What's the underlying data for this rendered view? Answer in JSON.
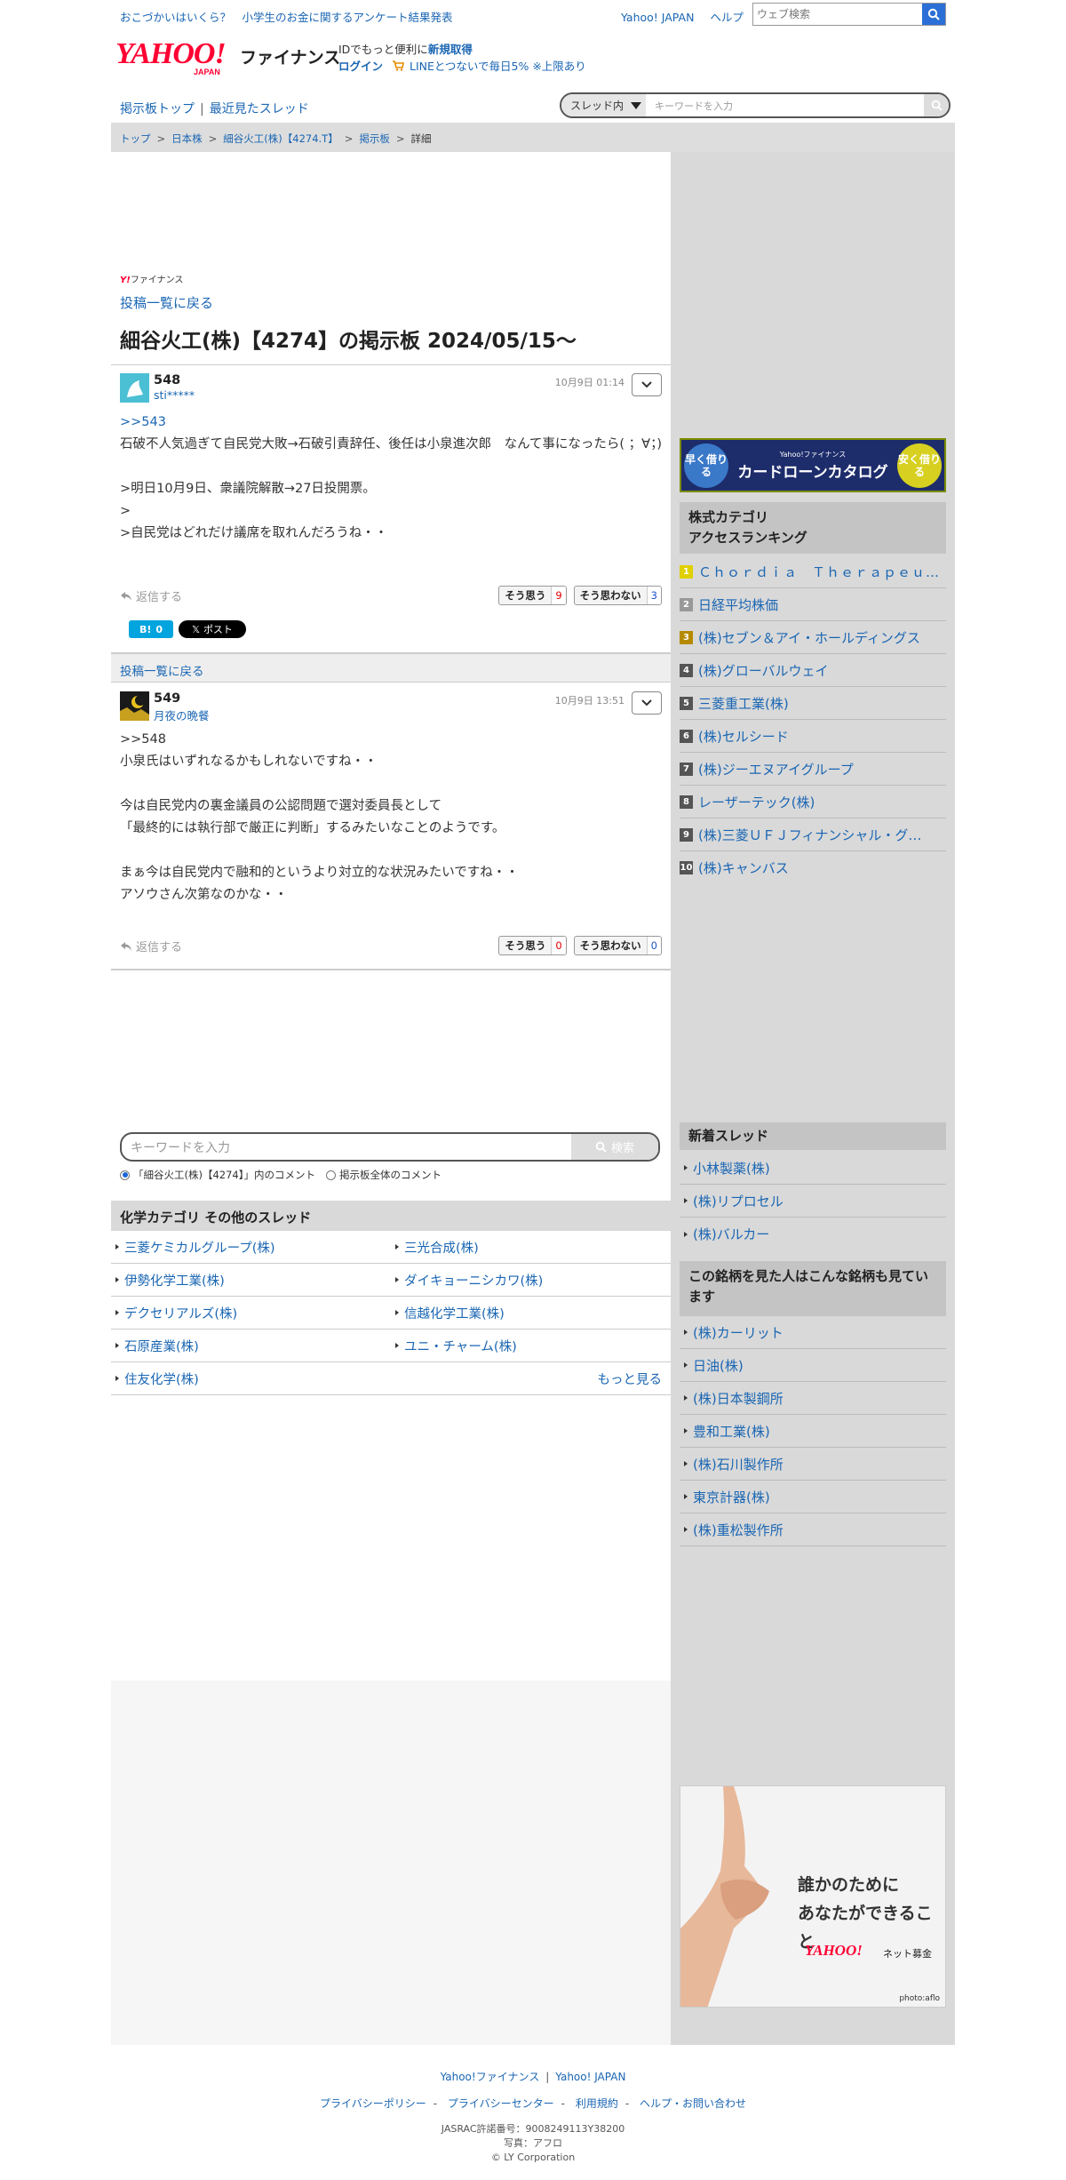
{
  "topbar": {
    "promo": "おこづかいはいくら？　小学生のお金に関するアンケート結果発表",
    "yahoo_japan": "Yahoo! JAPAN",
    "help": "ヘルプ",
    "web_search_placeholder": "ウェブ検索"
  },
  "header": {
    "logo_text": "YAHOO!",
    "logo_sub": "JAPAN",
    "service": "ファイナンス",
    "id_prefix": "IDでもっと便利に",
    "signup": "新規取得",
    "login": "ログイン",
    "line_promo": "LINEとつないで毎日5% ※上限あり"
  },
  "subnav": {
    "board_top": "掲示板トップ",
    "recent": "最近見たスレッド",
    "scope": "スレッド内",
    "search_placeholder": "キーワードを入力"
  },
  "breadcrumb": [
    "トップ",
    "日本株",
    "細谷火工(株)【4274.T】",
    "掲示板",
    "詳細"
  ],
  "board": {
    "mini_brand": "ファイナンス",
    "mini_brand_y": "Y!",
    "back_to_list": "投稿一覧に戻る",
    "title": "細谷火工(株)【4274】の掲示板 2024/05/15〜"
  },
  "posts": [
    {
      "number": "548",
      "user": "sti*****",
      "date": "10月9日 01:14",
      "reply_ref": ">>543",
      "lines": [
        "石破不人気過ぎて自民党大敗→石破引責辞任、後任は小泉進次郎　なんて事になったら( ；∀；)",
        "",
        ">明日10月9日、衆議院解散→27日投開票。",
        ">",
        ">自民党はどれだけ議席を取れんだろうね・・"
      ],
      "reply_label": "返信する",
      "agree_label": "そう思う",
      "agree_count": "9",
      "disagree_label": "そう思わない",
      "disagree_count": "3"
    },
    {
      "number": "549",
      "user": "月夜の晩餐",
      "date": "10月9日 13:51",
      "reply_ref": ">>548",
      "lines": [
        "小泉氏はいずれなるかもしれないですね・・",
        "",
        "今は自民党内の裏金議員の公認問題で選対委員長として",
        "「最終的には執行部で厳正に判断」するみたいなことのようです。",
        "",
        "まぁ今は自民党内で融和的というより対立的な状況みたいですね・・",
        "アソウさん次第なのかな・・"
      ],
      "reply_label": "返信する",
      "agree_label": "そう思う",
      "agree_count": "0",
      "disagree_label": "そう思わない",
      "disagree_count": "0"
    }
  ],
  "share": {
    "hatena_label": "B!",
    "hatena_count": "0",
    "x_label": "ポスト",
    "x_logo": "𝕏"
  },
  "back_bar": "投稿一覧に戻る",
  "bottom_search": {
    "placeholder": "キーワードを入力",
    "button": "検索",
    "radio_in_board": "「細谷火工(株)【4274】」内のコメント",
    "radio_all": "掲示板全体のコメント"
  },
  "other_threads": {
    "heading": "化学カテゴリ  その他のスレッド",
    "items": [
      "三菱ケミカルグループ(株)",
      "三光合成(株)",
      "伊勢化学工業(株)",
      "ダイキョーニシカワ(株)",
      "デクセリアルズ(株)",
      "信越化学工業(株)",
      "石原産業(株)",
      "ユニ・チャーム(株)",
      "住友化学(株)"
    ],
    "more": "もっと見る"
  },
  "side": {
    "loan_ad": {
      "left": "早く借りる",
      "brand": "Yahoo!ファイナンス",
      "title": "カードローンカタログ",
      "right": "安く借りる"
    },
    "ranking_heading_1": "株式カテゴリ",
    "ranking_heading_2": "アクセスランキング",
    "ranking": [
      "Ｃｈｏｒｄｉａ　Ｔｈｅｒａｐｅｕ…",
      "日経平均株価",
      "(株)セブン＆アイ・ホールディングス",
      "(株)グローバルウェイ",
      "三菱重工業(株)",
      "(株)セルシード",
      "(株)ジーエヌアイグループ",
      "レーザーテック(株)",
      "(株)三菱ＵＦＪフィナンシャル・グ…",
      "(株)キャンバス"
    ],
    "ranking_numbers": [
      "1",
      "2",
      "3",
      "4",
      "5",
      "6",
      "7",
      "8",
      "9",
      "10"
    ],
    "new_threads_heading": "新着スレッド",
    "new_threads": [
      "小林製薬(株)",
      "(株)リプロセル",
      "(株)バルカー"
    ],
    "also_viewed_heading": "この銘柄を見た人はこんな銘柄も見ています",
    "also_viewed": [
      "(株)カーリット",
      "日油(株)",
      "(株)日本製鋼所",
      "豊和工業(株)",
      "(株)石川製作所",
      "東京計器(株)",
      "(株)重松製作所"
    ],
    "donation_ad": {
      "line1": "誰かのために",
      "line2": "あなたができること",
      "brand": "YAHOO!",
      "brand_sub": "ネット募金",
      "credit": "photo:aflo"
    }
  },
  "footer": {
    "links1": [
      "Yahoo!ファイナンス",
      "Yahoo! JAPAN"
    ],
    "links2": [
      "プライバシーポリシー",
      "プライバシーセンター",
      "利用規約",
      "ヘルプ・お問い合わせ"
    ],
    "jasrac": "JASRAC許諾番号：9008249113Y38200",
    "photo": "写真：アフロ",
    "copyright": "© LY Corporation"
  },
  "colors": {
    "link": "#1a66b3",
    "brand_red": "#ff0033",
    "accent_blue": "#2b6fd6"
  }
}
